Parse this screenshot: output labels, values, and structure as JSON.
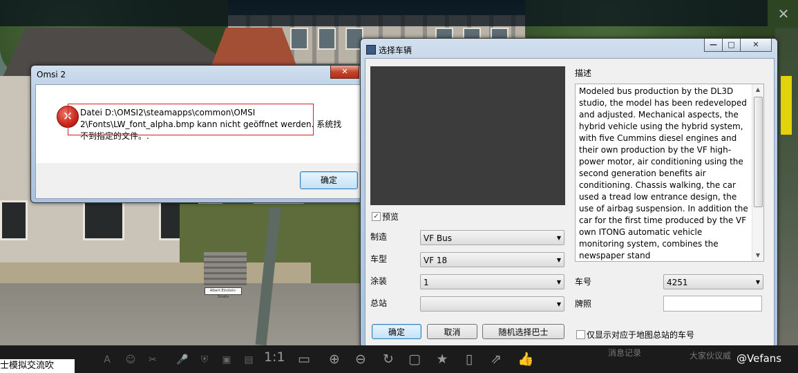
{
  "viewer": {
    "close_glyph": "✕",
    "watermark": "@Vefans",
    "chat_label": "士模拟交流吹",
    "history_label": "消息记录",
    "group_label": "大家伙议威",
    "zoom_label": "1:1",
    "tools": [
      "font-icon",
      "emoji-icon",
      "scissors-icon",
      "mic-icon",
      "shield-icon",
      "image-icon",
      "bag-icon"
    ],
    "actions": [
      "fullscreen-icon",
      "zoom-in-icon",
      "zoom-out-icon",
      "rotate-icon",
      "save-icon",
      "bookmark-icon",
      "tablet-icon",
      "share-icon",
      "like-icon"
    ]
  },
  "message_box": {
    "title": "Omsi 2",
    "close_glyph": "✕",
    "icon": "error-icon",
    "message_line1": "Datei D:\\OMSI2\\steamapps\\common\\OMSI",
    "message_line2": "2\\Fonts\\LW_font_alpha.bmp kann nicht geöffnet werden. 系统找",
    "message_line3": "不到指定的文件。.",
    "ok_label": "确定"
  },
  "vehicle_dialog": {
    "title": "选择车辆",
    "min_glyph": "—",
    "max_glyph": "□",
    "close_glyph": "✕",
    "preview_label": "预览",
    "preview_checked": true,
    "description_label": "描述",
    "description_text": "Modeled bus production by the DL3D studio, the model has been redeveloped and adjusted. Mechanical aspects, the hybrid vehicle using the hybrid system, with five Cummins diesel engines and their own production by the VF high-power motor, air conditioning using the second generation benefits air conditioning. Chassis walking, the car used a tread low entrance design, the use of airbag suspension. In addition the car for the first time produced by the VF own ITONG automatic vehicle monitoring system, combines the newspaper stand",
    "manufacturer_label": "制造",
    "manufacturer_value": "VF Bus",
    "model_label": "车型",
    "model_value": "VF 18",
    "livery_label": "涂装",
    "livery_value": "1",
    "depot_label": "总站",
    "depot_value": "",
    "number_label": "车号",
    "number_value": "4251",
    "plate_label": "牌照",
    "plate_value": "",
    "ok_label": "确定",
    "cancel_label": "取消",
    "random_label": "随机选择巴士",
    "only_depot_label": "仅显示对应于地图总站的车号",
    "only_depot_checked": false
  }
}
